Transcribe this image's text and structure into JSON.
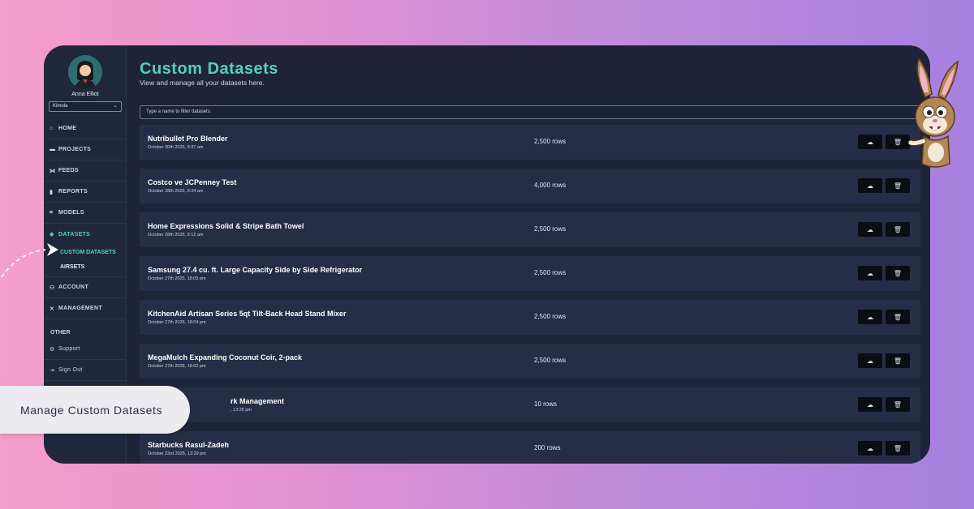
{
  "user": {
    "name": "Anna Elliot",
    "org": "Kimola"
  },
  "nav": [
    {
      "icon": "⌂",
      "icon_name": "home-icon",
      "label": "HOME"
    },
    {
      "icon": "▬",
      "icon_name": "folder-icon",
      "label": "PROJECTS"
    },
    {
      "icon": "⋈",
      "icon_name": "feeds-icon",
      "label": "FEEDS"
    },
    {
      "icon": "▮",
      "icon_name": "bar-chart-icon",
      "label": "REPORTS"
    },
    {
      "icon": "⌗",
      "icon_name": "models-icon",
      "label": "MODELS"
    }
  ],
  "datasets": {
    "label": "DATASETS",
    "icon": "◈",
    "sub": [
      "CUSTOM DATASETS",
      "AIRSETS"
    ]
  },
  "nav2": [
    {
      "icon": "⚇",
      "icon_name": "account-icon",
      "label": "ACCOUNT"
    },
    {
      "icon": "✕",
      "icon_name": "tools-icon",
      "label": "MANAGEMENT"
    }
  ],
  "other": {
    "heading": "OTHER",
    "items": [
      {
        "icon": "⚙",
        "icon_name": "support-icon",
        "label": "Support"
      },
      {
        "icon": "⇥",
        "icon_name": "sign-out-icon",
        "label": "Sign Out"
      }
    ]
  },
  "page": {
    "title": "Custom Datasets",
    "subtitle": "View and manage all your datasets here.",
    "filter_placeholder": "Type a name to filter datasets."
  },
  "rows": [
    {
      "name": "Nutribullet Pro Blender",
      "date": "October 30th 2025, 9:37 am",
      "count": "2,500 rows"
    },
    {
      "name": "Costco ve JCPenney Test",
      "date": "October 28th 2025, 9:34 am",
      "count": "4,000 rows"
    },
    {
      "name": "Home Expressions Solid & Stripe Bath Towel",
      "date": "October 28th 2025, 9:12 am",
      "count": "2,500 rows"
    },
    {
      "name": "Samsung 27.4 cu. ft. Large Capacity Side by Side Refrigerator",
      "date": "October 27th 2025, 18:05 pm",
      "count": "2,500 rows"
    },
    {
      "name": "KitchenAid Artisan Series 5qt Tilt-Back Head Stand Mixer",
      "date": "October 27th 2025, 18:04 pm",
      "count": "2,500 rows"
    },
    {
      "name": "MegaMulch Expanding Coconut Coir, 2-pack",
      "date": "October 27th 2025, 18:02 pm",
      "count": "2,500 rows"
    },
    {
      "name": "rk Management",
      "date": ", 13:25 pm",
      "count": "10 rows"
    },
    {
      "name": "Starbucks Rasul-Zadeh",
      "date": "October 23rd 2025, 13:29 pm",
      "count": "200 rows"
    }
  ],
  "actions": {
    "download_icon": "☁",
    "delete_icon": "🗑"
  },
  "callout": "Manage Custom Datasets",
  "colors": {
    "accent": "#4fd1c5",
    "panel": "#1e2337",
    "row": "#262d47"
  }
}
